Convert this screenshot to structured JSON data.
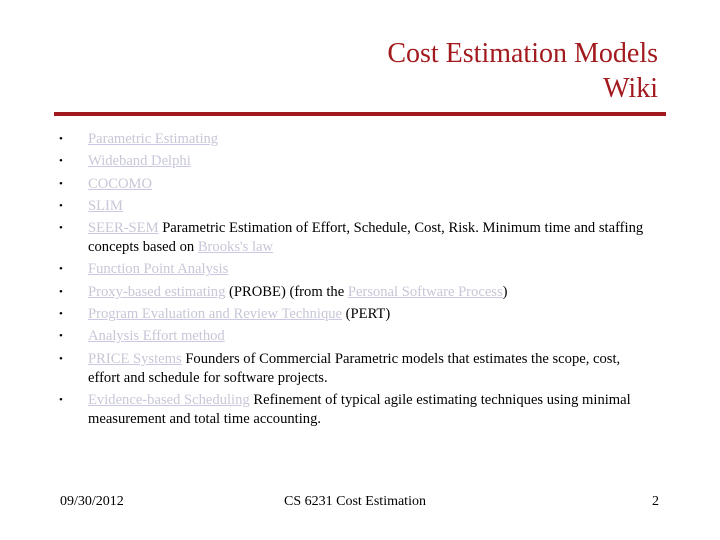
{
  "slide": {
    "title_line1": "Cost Estimation Models",
    "title_line2": "Wiki",
    "accent_color": "#a31a1e",
    "link_color": "#c7c7d8",
    "bullets": [
      {
        "link": "Parametric Estimating",
        "text": ""
      },
      {
        "link": "Wideband Delphi",
        "text": ""
      },
      {
        "link": "COCOMO",
        "text": ""
      },
      {
        "link": "SLIM",
        "text": ""
      },
      {
        "link": "SEER-SEM",
        "text": " Parametric Estimation of Effort, Schedule, Cost, Risk. Minimum time and staffing concepts based on ",
        "link2": "Brooks's law",
        "text2": ""
      },
      {
        "link": "Function Point Analysis",
        "text": ""
      },
      {
        "link": "Proxy-based estimating",
        "text": " (PROBE) (from the ",
        "link2": "Personal Software Process",
        "text2": ")"
      },
      {
        "link": "Program Evaluation and Review Technique",
        "text": " (PERT)"
      },
      {
        "link": "Analysis Effort method",
        "text": ""
      },
      {
        "link": "PRICE Systems",
        "text": " Founders of Commercial Parametric models that estimates the scope, cost, effort and schedule for software projects."
      },
      {
        "link": "Evidence-based Scheduling",
        "text": " Refinement of typical agile estimating techniques using minimal measurement and total time accounting."
      }
    ],
    "bullet_glyph": "•"
  },
  "footer": {
    "date": "09/30/2012",
    "center": "CS 6231 Cost Estimation",
    "page": "2"
  }
}
